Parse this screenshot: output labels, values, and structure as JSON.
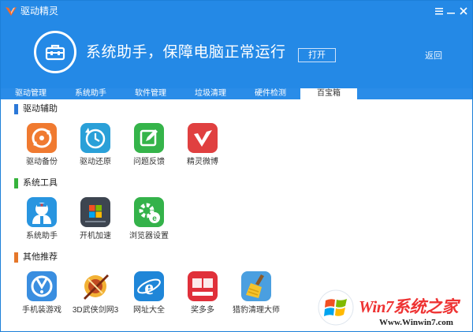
{
  "window": {
    "title": "驱动精灵",
    "controls": [
      "menu-icon",
      "minimize-icon",
      "close-icon"
    ]
  },
  "banner": {
    "icon": "toolbox-icon",
    "text": "系统助手，保障电脑正常运行",
    "open_button": "打开",
    "back_link": "返回"
  },
  "tabs": [
    {
      "label": "驱动管理",
      "active": false
    },
    {
      "label": "系统助手",
      "active": false
    },
    {
      "label": "软件管理",
      "active": false
    },
    {
      "label": "垃圾清理",
      "active": false
    },
    {
      "label": "硬件检测",
      "active": false
    },
    {
      "label": "百宝箱",
      "active": true
    }
  ],
  "sections": [
    {
      "title": "驱动辅助",
      "color": "#2b78d8",
      "apps": [
        {
          "label": "驱动备份",
          "icon": "backup-icon",
          "color": "#f07a30"
        },
        {
          "label": "驱动还原",
          "icon": "restore-icon",
          "color": "#2aa0d8"
        },
        {
          "label": "问题反馈",
          "icon": "feedback-icon",
          "color": "#35b44a"
        },
        {
          "label": "精灵微博",
          "icon": "weibo-icon",
          "color": "#e04040"
        }
      ]
    },
    {
      "title": "系统工具",
      "color": "#36b33c",
      "apps": [
        {
          "label": "系统助手",
          "icon": "doctor-icon",
          "color": "#2895e0"
        },
        {
          "label": "开机加速",
          "icon": "boot-speed-icon",
          "color": "#3d4550"
        },
        {
          "label": "浏览器设置",
          "icon": "browser-settings-icon",
          "color": "#34b24a"
        }
      ]
    },
    {
      "title": "其他推荐",
      "color": "#e5772a",
      "apps": [
        {
          "label": "手机装游戏",
          "icon": "mobile-game-icon",
          "color": "#3a8ee0"
        },
        {
          "label": "3D武侠剑网3",
          "icon": "jx3-icon",
          "color": "#c04a20"
        },
        {
          "label": "网址大全",
          "icon": "ie-icon",
          "color": "#1f86d8"
        },
        {
          "label": "奖多多",
          "icon": "lottery-icon",
          "color": "#e0303a"
        },
        {
          "label": "猎豹清理大师",
          "icon": "broom-icon",
          "color": "#4a9fe0"
        }
      ]
    }
  ],
  "watermark": {
    "title": "Win7系统之家",
    "url": "Www.Winwin7.com",
    "logo": "windows-logo-icon"
  },
  "colors": {
    "header": "#2489e6",
    "tab_bar": "#2a8ce8"
  }
}
